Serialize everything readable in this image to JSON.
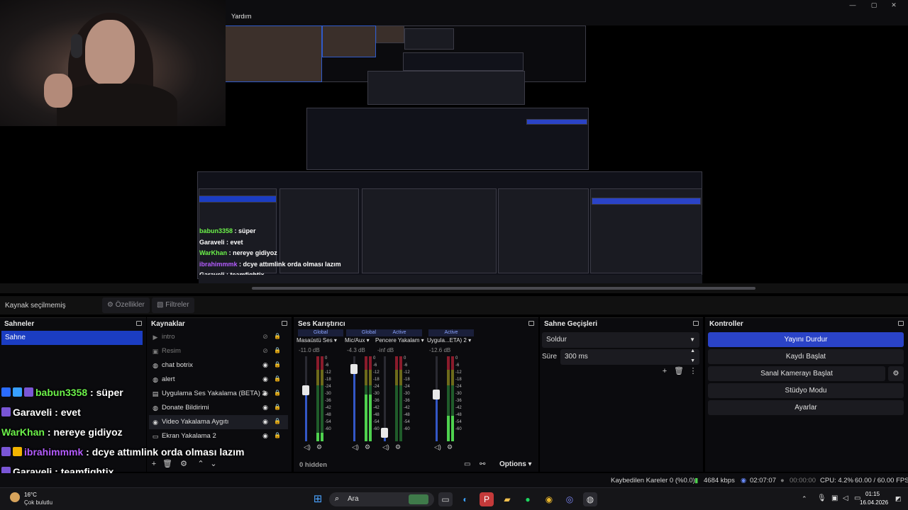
{
  "menu": {
    "help": "Yardım"
  },
  "preview": {
    "nested_chat": [
      {
        "user": "babun3358",
        "msg": " : süper",
        "color": "#6cf24a"
      },
      {
        "user": "Garaveli",
        "msg": " : evet",
        "color": "#ffffff"
      },
      {
        "user": "WarKhan",
        "msg": " : nereye gidiyoz",
        "color": "#6cf24a"
      },
      {
        "user": "ibrahimmmk",
        "msg": " : dcye attımlink orda olması lazım",
        "color": "#b45cff"
      },
      {
        "user": "Garaveli",
        "msg": " : teamfightix",
        "color": "#ffffff"
      }
    ]
  },
  "context": {
    "no_source": "Kaynak seçilmemiş",
    "properties": "Özellikler",
    "filters": "Filtreler"
  },
  "scenes": {
    "title": "Sahneler",
    "items": [
      "Sahne"
    ]
  },
  "sources": {
    "title": "Kaynaklar",
    "items": [
      {
        "label": "intro",
        "icon": "▶",
        "hidden": true
      },
      {
        "label": "Resim",
        "icon": "▣",
        "hidden": true
      },
      {
        "label": "chat botrix",
        "icon": "◍",
        "hidden": false
      },
      {
        "label": "alert",
        "icon": "◍",
        "hidden": false
      },
      {
        "label": "Uygulama Ses Yakalama (BETA) 2",
        "icon": "▤",
        "hidden": false
      },
      {
        "label": "Donate Bildirimi",
        "icon": "◍",
        "hidden": false
      },
      {
        "label": "Video Yakalama Aygıtı",
        "icon": "◉",
        "hidden": false
      },
      {
        "label": "Ekran Yakalama 2",
        "icon": "▭",
        "hidden": false
      }
    ]
  },
  "mixer": {
    "title": "Ses Karıştırıcı",
    "hidden_count": "0 hidden",
    "options": "Options",
    "scale": [
      "0",
      "-6",
      "-12",
      "-18",
      "-24",
      "-30",
      "-36",
      "-42",
      "-48",
      "-54",
      "-60"
    ],
    "channels": [
      {
        "tag": "Global",
        "name": "Masaüstü Ses",
        "db": "-11.0 dB",
        "volume": 0.6,
        "level": 0.1
      },
      {
        "tag": "Global",
        "name": "Mic/Aux",
        "db": "-4.3 dB",
        "volume": 0.85,
        "level": 0.55
      },
      {
        "tag": "Active",
        "name": "Pencere Yakalam",
        "db": "-inf dB",
        "volume": 0.1,
        "level": 0.0
      },
      {
        "tag": "Active",
        "name": "Uygula...ETA) 2",
        "db": "-12.6 dB",
        "volume": 0.55,
        "level": 0.3
      }
    ]
  },
  "transitions": {
    "title": "Sahne Geçişleri",
    "type": "Soldur",
    "duration_label": "Süre",
    "duration": "300 ms"
  },
  "controls": {
    "title": "Kontroller",
    "stop_stream": "Yayını Durdur",
    "start_record": "Kaydı Başlat",
    "virtual_cam": "Sanal Kamerayı Başlat",
    "studio_mode": "Stüdyo Modu",
    "settings": "Ayarlar"
  },
  "chat": [
    {
      "user": "babun3358",
      "msg": " : süper",
      "color": "#6cf24a",
      "badges": [
        "#2b6cff",
        "#38a0ff",
        "#7a56d6"
      ]
    },
    {
      "user": "Garaveli",
      "msg": " : evet",
      "color": "#ffffff",
      "badges": [
        "#7a56d6"
      ]
    },
    {
      "user": "WarKhan",
      "msg": " : nereye gidiyoz",
      "color": "#6cf24a",
      "badges": []
    },
    {
      "user": "ibrahimmmk",
      "msg": " : dcye attımlink orda olması lazım",
      "color": "#b45cff",
      "badges": [
        "#7a56d6",
        "#f2b400"
      ]
    },
    {
      "user": "Garaveli",
      "msg": " : teamfightix",
      "color": "#ffffff",
      "badges": [
        "#7a56d6"
      ]
    }
  ],
  "status": {
    "dropped_frames": "Kaybedilen Kareler 0 (%0.0)",
    "bitrate": "4684 kbps",
    "stream_time": "02:07:07",
    "record_time": "00:00:00",
    "cpu": "CPU: 4.2%",
    "fps": "60.00 / 60.00 FPS"
  },
  "taskbar": {
    "temperature": "16°C",
    "weather": "Çok bulutlu",
    "search": "Ara",
    "time": "01:15",
    "date": "16.04.2026"
  }
}
